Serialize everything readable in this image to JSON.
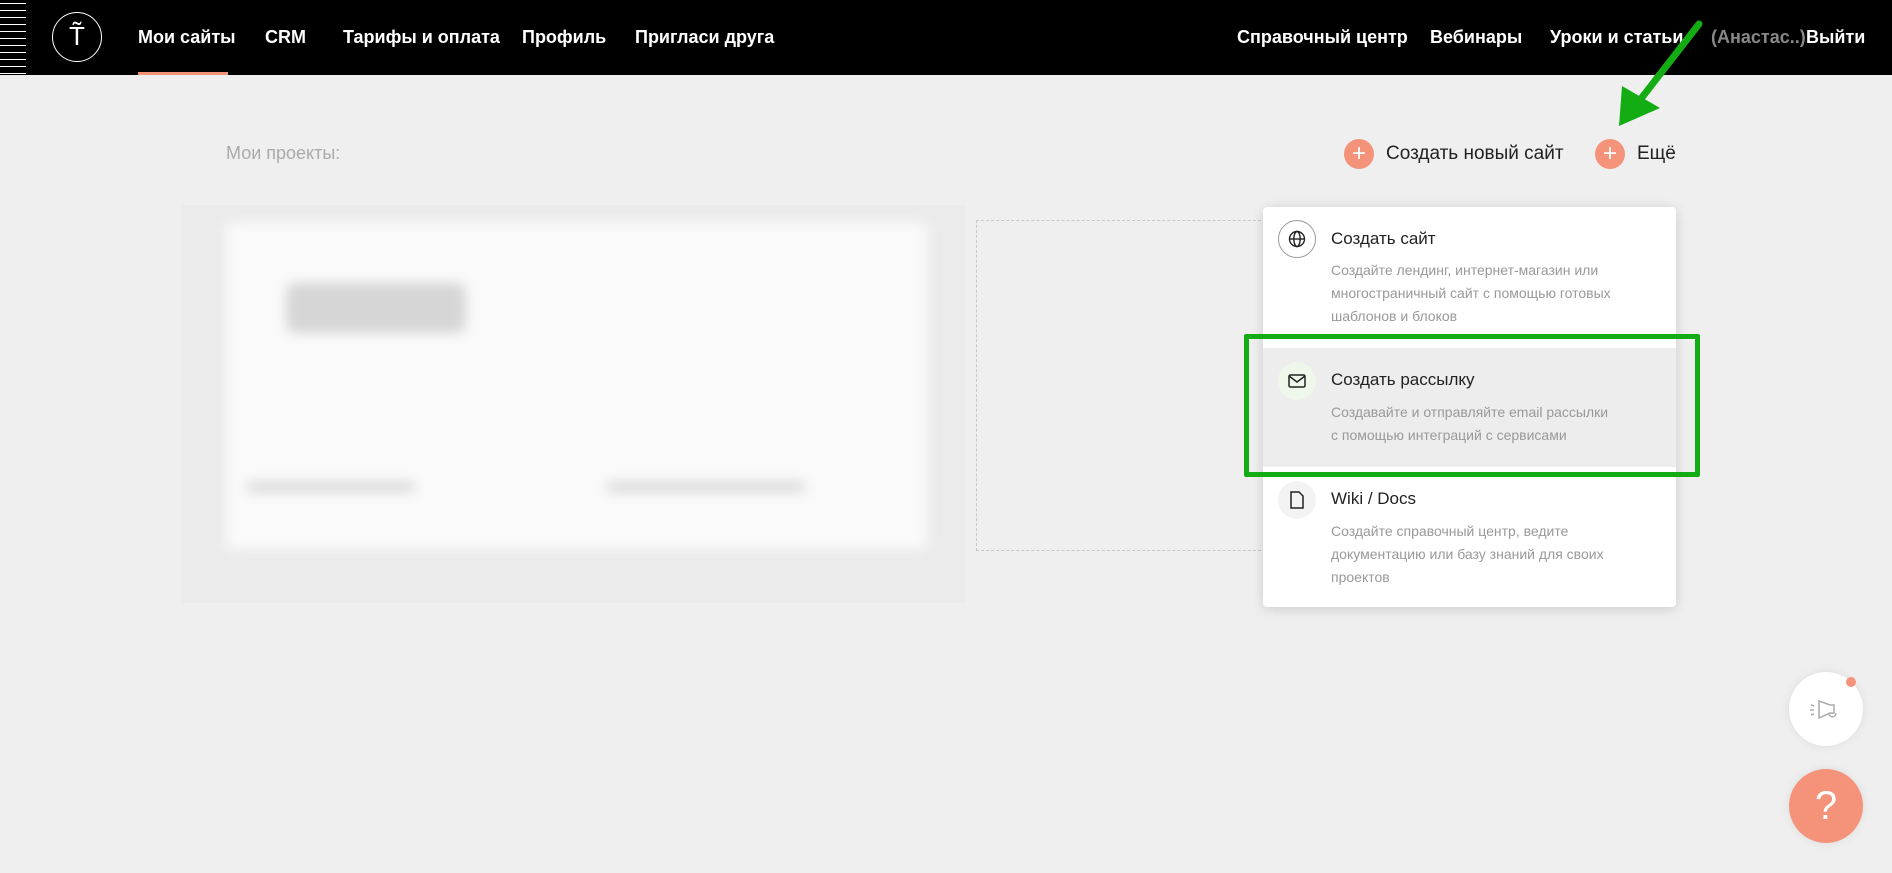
{
  "nav": {
    "logo": "T̃",
    "items": [
      "Мои сайты",
      "CRM",
      "Тарифы и оплата",
      "Профиль",
      "Пригласи друга"
    ],
    "right": [
      "Справочный центр",
      "Вебинары",
      "Уроки и статьи"
    ],
    "user": "(Анастас..)",
    "logout": "Выйти"
  },
  "main": {
    "projects_label": "Мои проекты:",
    "create_site": "Создать новый сайт",
    "more": "Ещё"
  },
  "dropdown": {
    "items": [
      {
        "icon": "globe-icon",
        "title": "Создать сайт",
        "desc": [
          "Создайте лендинг, интернет-магазин или",
          "многостраничный сайт с помощью готовых",
          "шаблонов и блоков"
        ]
      },
      {
        "icon": "mail-icon",
        "title": "Создать рассылку",
        "desc": [
          "Создавайте и отправляйте email рассылки",
          "с помощью интеграций с сервисами"
        ]
      },
      {
        "icon": "document-icon",
        "title": "Wiki / Docs",
        "desc": [
          "Создайте справочный центр, ведите",
          "документацию или базу знаний для своих",
          "проектов"
        ]
      }
    ]
  },
  "widgets": {
    "help": "?"
  },
  "colors": {
    "accent": "#f4937a",
    "highlight": "#13ad13",
    "nav_bg": "#000000"
  }
}
